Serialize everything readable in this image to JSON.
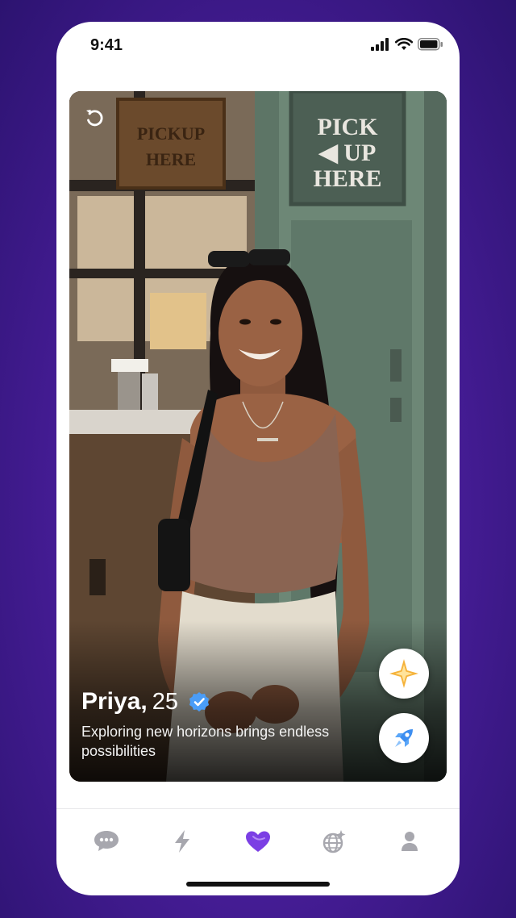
{
  "status_bar": {
    "time": "9:41"
  },
  "photo": {
    "left_sign": [
      "PICKUP",
      "HERE"
    ],
    "right_sign": [
      "PICK",
      "◀ UP",
      "HERE"
    ]
  },
  "profile": {
    "name": "Priya,",
    "age": "25",
    "verified": true,
    "bio": "Exploring new horizons brings endless possibilities"
  },
  "actions": {
    "undo_icon": "undo-icon",
    "superlike_icon": "sparkle-icon",
    "boost_icon": "rocket-icon"
  },
  "tabs": [
    {
      "icon": "chat-bubble-icon",
      "active": false
    },
    {
      "icon": "lightning-icon",
      "active": false
    },
    {
      "icon": "heart-icon",
      "active": true
    },
    {
      "icon": "globe-icon",
      "active": false
    },
    {
      "icon": "person-icon",
      "active": false
    }
  ],
  "colors": {
    "background": "#4a1e9c",
    "accent": "#7b3fe4",
    "tab_inactive": "#a7a7ae",
    "verified_blue": "#4a9df8",
    "sparkle_gold": "#f5b23a",
    "rocket_blue": "#3d8ef0"
  }
}
